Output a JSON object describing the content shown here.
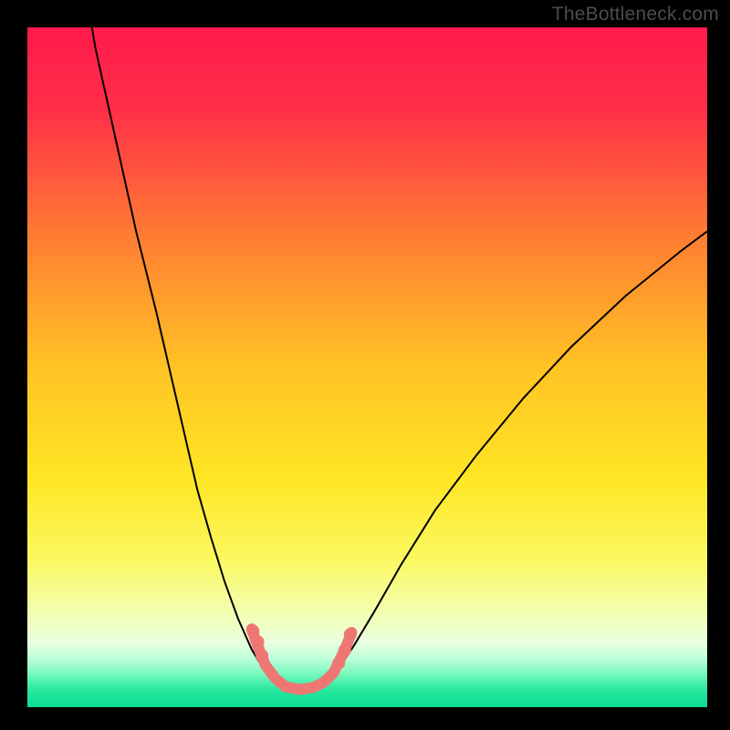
{
  "watermark": "TheBottleneck.com",
  "chart_data": {
    "type": "line",
    "title": "",
    "xlabel": "",
    "ylabel": "",
    "xlim": [
      0,
      100
    ],
    "ylim": [
      0,
      100
    ],
    "gradient_stops": [
      {
        "pos": 0.0,
        "color": "#ff1a4b"
      },
      {
        "pos": 0.12,
        "color": "#ff2f48"
      },
      {
        "pos": 0.3,
        "color": "#ff7a33"
      },
      {
        "pos": 0.5,
        "color": "#ffc324"
      },
      {
        "pos": 0.66,
        "color": "#ffe524"
      },
      {
        "pos": 0.78,
        "color": "#fbf85e"
      },
      {
        "pos": 0.86,
        "color": "#f3ffb0"
      },
      {
        "pos": 0.905,
        "color": "#e9ffe0"
      },
      {
        "pos": 0.93,
        "color": "#b9ffd7"
      },
      {
        "pos": 0.955,
        "color": "#6bf7b8"
      },
      {
        "pos": 0.975,
        "color": "#26e79e"
      },
      {
        "pos": 1.0,
        "color": "#0bdc90"
      }
    ],
    "series": [
      {
        "name": "left-curve",
        "color": "#000000",
        "width": 2,
        "x": [
          9.5,
          10,
          12,
          14,
          16,
          19,
          22,
          25,
          27,
          29,
          31,
          33,
          34.5,
          36,
          37.5
        ],
        "y": [
          100,
          97,
          88,
          79,
          70,
          58,
          45,
          32,
          25,
          18.5,
          13,
          8.5,
          6,
          4.2,
          3.2
        ]
      },
      {
        "name": "right-curve",
        "color": "#000000",
        "width": 2,
        "x": [
          43,
          44.5,
          46,
          48,
          51,
          55,
          60,
          66,
          73,
          80,
          88,
          96,
          100
        ],
        "y": [
          3.4,
          4.5,
          6,
          9,
          14,
          21,
          29,
          37,
          45.5,
          53,
          60.5,
          67,
          70
        ]
      },
      {
        "name": "bottom-trace",
        "color": "#ef7773",
        "width": 12,
        "line_cap": "round",
        "x": [
          33,
          33.6,
          34.2,
          35,
          36.5,
          38,
          40,
          42,
          43.5,
          45,
          46,
          47,
          47.7
        ],
        "y": [
          11.5,
          9.8,
          8.2,
          6.2,
          4.2,
          3.0,
          2.6,
          2.9,
          3.6,
          5.0,
          7.0,
          9.2,
          11.0
        ]
      }
    ],
    "markers": {
      "name": "highlight-dots",
      "color": "#ef7773",
      "radius": 7,
      "points": [
        {
          "x": 33.2,
          "y": 11.2
        },
        {
          "x": 33.9,
          "y": 9.6
        },
        {
          "x": 34.5,
          "y": 7.6
        },
        {
          "x": 45.8,
          "y": 6.5
        },
        {
          "x": 46.7,
          "y": 8.4
        },
        {
          "x": 47.5,
          "y": 10.7
        }
      ]
    }
  }
}
